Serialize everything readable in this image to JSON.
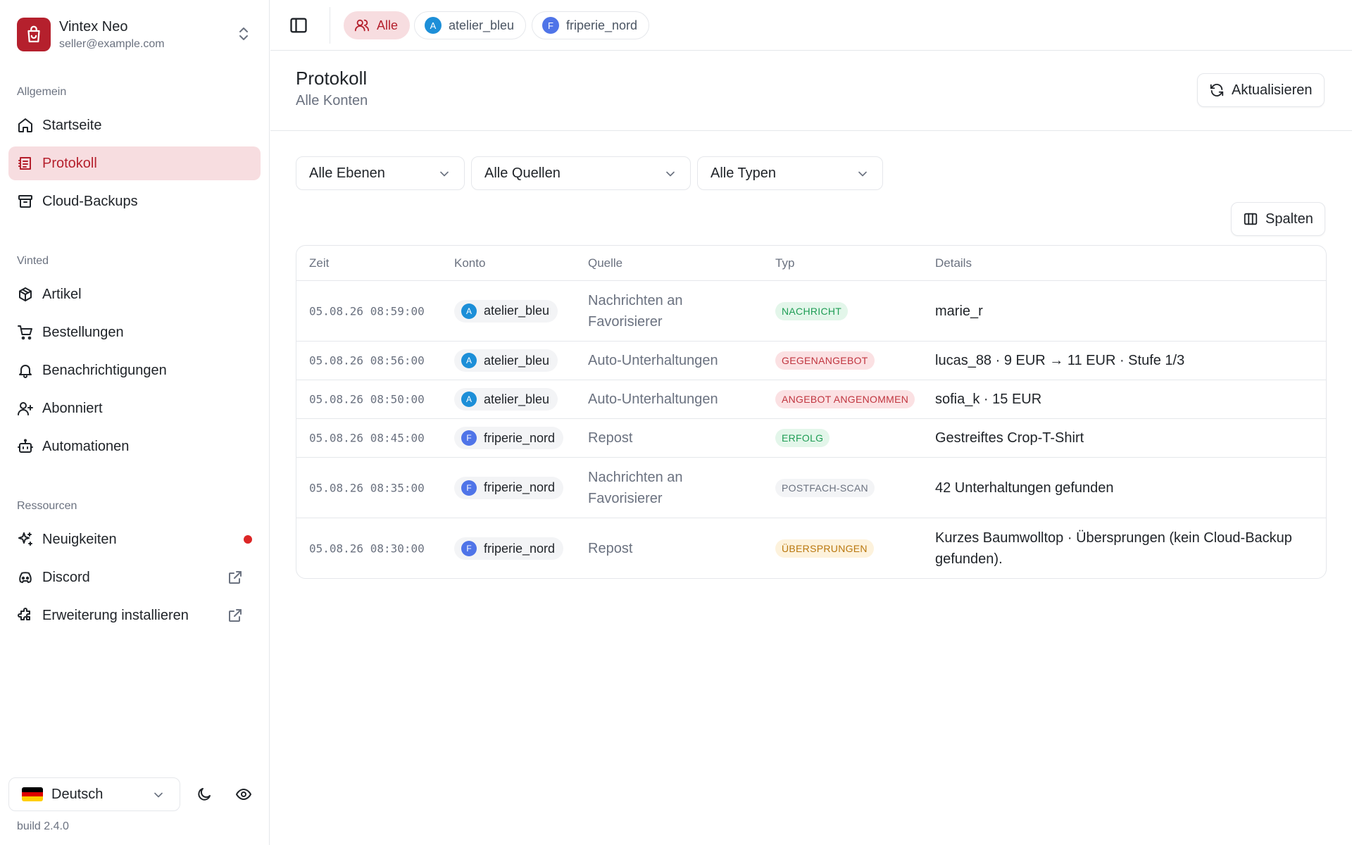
{
  "brand": {
    "name": "Vintex Neo",
    "email": "seller@example.com"
  },
  "sidebar": {
    "groups": [
      {
        "label": "Allgemein"
      },
      {
        "label": "Vinted"
      },
      {
        "label": "Ressourcen"
      }
    ],
    "items": [
      {
        "label": "Startseite",
        "icon": "home-icon"
      },
      {
        "label": "Protokoll",
        "icon": "log-icon",
        "active": true
      },
      {
        "label": "Cloud-Backups",
        "icon": "archive-icon"
      },
      {
        "label": "Artikel",
        "icon": "package-icon"
      },
      {
        "label": "Bestellungen",
        "icon": "cart-icon"
      },
      {
        "label": "Benachrichtigungen",
        "icon": "bell-icon"
      },
      {
        "label": "Abonniert",
        "icon": "user-plus-icon"
      },
      {
        "label": "Automationen",
        "icon": "bot-icon"
      },
      {
        "label": "Neuigkeiten",
        "icon": "sparkles-icon",
        "badge_color": "#dc2626"
      },
      {
        "label": "Discord",
        "icon": "discord-icon"
      },
      {
        "label": "Erweiterung installieren",
        "icon": "puzzle-icon"
      }
    ],
    "language": "Deutsch",
    "build": "build 2.4.0"
  },
  "topbar": {
    "chips": [
      {
        "label": "Alle",
        "active": true
      },
      {
        "label": "atelier_bleu",
        "avatar": "A"
      },
      {
        "label": "friperie_nord",
        "avatar": "F"
      }
    ]
  },
  "header": {
    "title": "Protokoll",
    "subtitle": "Alle Konten",
    "refresh_label": "Aktualisieren"
  },
  "filters": {
    "levels": "Alle Ebenen",
    "sources": "Alle Quellen",
    "types": "Alle Typen",
    "columns_label": "Spalten"
  },
  "table": {
    "columns": [
      "Zeit",
      "Konto",
      "Quelle",
      "Typ",
      "Details"
    ],
    "rows": [
      {
        "time": "05.08.26 08:59:00",
        "account": "atelier_bleu",
        "avatar": "A",
        "source": "Nachrichten an Favorisierer",
        "type": "NACHRICHT",
        "details": "marie_r"
      },
      {
        "time": "05.08.26 08:56:00",
        "account": "atelier_bleu",
        "avatar": "A",
        "source": "Auto-Unterhaltungen",
        "type": "GEGENANGEBOT",
        "details": "lucas_88 · 9 EUR → 11 EUR · Stufe 1/3"
      },
      {
        "time": "05.08.26 08:50:00",
        "account": "atelier_bleu",
        "avatar": "A",
        "source": "Auto-Unterhaltungen",
        "type": "ANGEBOT ANGENOMMEN",
        "details": "sofia_k · 15 EUR"
      },
      {
        "time": "05.08.26 08:45:00",
        "account": "friperie_nord",
        "avatar": "F",
        "source": "Repost",
        "type": "ERFOLG",
        "details": "Gestreiftes Crop-T-Shirt"
      },
      {
        "time": "05.08.26 08:35:00",
        "account": "friperie_nord",
        "avatar": "F",
        "source": "Nachrichten an Favorisierer",
        "type": "POSTFACH-SCAN",
        "details": "42 Unterhaltungen gefunden"
      },
      {
        "time": "05.08.26 08:30:00",
        "account": "friperie_nord",
        "avatar": "F",
        "source": "Repost",
        "type": "ÜBERSPRUNGEN",
        "details": "Kurzes Baumwolltop · Übersprungen (kein Cloud-Backup gefunden)."
      }
    ]
  }
}
